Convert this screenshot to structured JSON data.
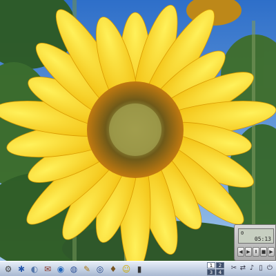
{
  "taskbar": {
    "launchers": [
      {
        "name": "system-menu-icon",
        "glyph": "⚙"
      },
      {
        "name": "kde-gear-icon",
        "glyph": "✱"
      },
      {
        "name": "konqueror-icon",
        "glyph": "◐"
      },
      {
        "name": "mail-icon",
        "glyph": "✉"
      },
      {
        "name": "globe-icon",
        "glyph": "◉"
      },
      {
        "name": "office-icon",
        "glyph": "◍"
      },
      {
        "name": "paint-icon",
        "glyph": "✎"
      },
      {
        "name": "messenger-icon",
        "glyph": "◎"
      },
      {
        "name": "photo-icon",
        "glyph": "♦"
      },
      {
        "name": "chat-icon",
        "glyph": "☺"
      },
      {
        "name": "terminal-icon",
        "glyph": "▮"
      }
    ],
    "pager": [
      "1",
      "2",
      "3",
      "4"
    ],
    "tray": [
      {
        "name": "clipboard-icon",
        "glyph": "✂"
      },
      {
        "name": "network-icon",
        "glyph": "⇄"
      },
      {
        "name": "sound-icon",
        "glyph": "♪"
      },
      {
        "name": "battery-icon",
        "glyph": "▯"
      },
      {
        "name": "power-icon",
        "glyph": "⏻"
      }
    ]
  },
  "media_player": {
    "track": "0",
    "time": "05:13"
  },
  "colors": {
    "sky": "#3f7fd0",
    "petal": "#ffd400",
    "disk": "#6b4a12",
    "center": "#a0a04a"
  }
}
